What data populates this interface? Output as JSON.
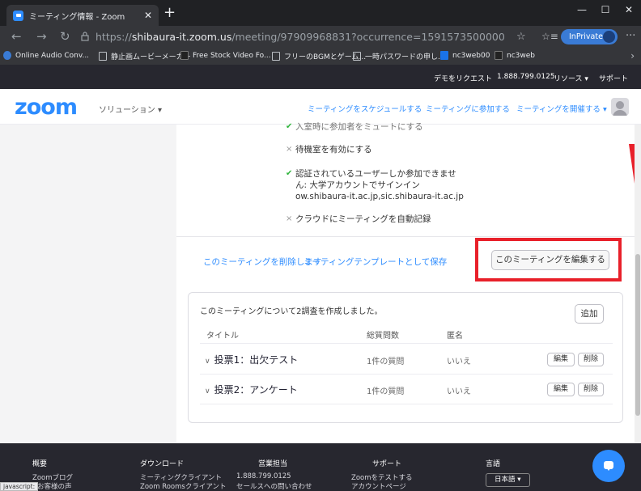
{
  "browser": {
    "tab_title": "ミーティング情報 - Zoom",
    "url_scheme": "https://",
    "url_host": "shibaura-it.zoom.us",
    "url_path": "/meeting/97909968831?occurrence=1591573500000",
    "inprivate_label": "InPrivate",
    "bookmarks": [
      "Online Audio Conv...",
      "静止画ムービーメーカー",
      "Free Stock Video Fo...",
      "フリーのBGMとゲーム...",
      "一時パスワードの申し...",
      "nc3web00",
      "nc3web"
    ]
  },
  "zoom_topbar": {
    "demo": "デモをリクエスト",
    "phone": "1.888.799.0125",
    "resources": "リソース ▾",
    "support": "サポート"
  },
  "zoom_nav": {
    "logo": "zoom",
    "solutions": "ソリューション ▾",
    "schedule": "ミーティングをスケジュールする",
    "join": "ミーティングに参加する",
    "host": "ミーティングを開催する ▾"
  },
  "options": {
    "partial": "入室時に参加者をミュートにする",
    "waiting_room": "待機室を有効にする",
    "auth_line1": "認証されているユーザーしか参加できませ",
    "auth_line2": "ん: 大学アカウントでサインイン",
    "auth_line3": "ow.shibaura-it.ac.jp,sic.shibaura-it.ac.jp",
    "cloud_record": "クラウドにミーティングを自動記録"
  },
  "actions": {
    "delete": "このミーティングを削除します",
    "save_template": "ミーティングテンプレートとして保存",
    "edit": "このミーティングを編集する"
  },
  "polls": {
    "intro": "このミーティングについて2調査を作成しました。",
    "add_label": "追加",
    "columns": [
      "タイトル",
      "総質問数",
      "匿名"
    ],
    "rows": [
      {
        "title": "投票1：出欠テスト",
        "questions": "1件の質問",
        "anonymous": "いいえ"
      },
      {
        "title": "投票2：アンケート",
        "questions": "1件の質問",
        "anonymous": "いいえ"
      }
    ],
    "edit_label": "編集",
    "delete_label": "削除"
  },
  "footer": {
    "cols": [
      {
        "head": "概要",
        "items": [
          "Zoomブログ",
          "お客様の声"
        ]
      },
      {
        "head": "ダウンロード",
        "items": [
          "ミーティングクライアント",
          "Zoom Roomsクライアント"
        ]
      },
      {
        "head": "営業担当",
        "items": [
          "1.888.799.0125",
          "セールスへの問い合わせ"
        ]
      },
      {
        "head": "サポート",
        "items": [
          "Zoomをテストする",
          "アカウントページ"
        ]
      },
      {
        "head": "言語",
        "items": []
      }
    ],
    "language": "日本語 ▾",
    "status": "javascript:"
  },
  "colors": {
    "accent": "#2d8cff",
    "highlight": "#e8202a",
    "dark": "#27272f"
  }
}
